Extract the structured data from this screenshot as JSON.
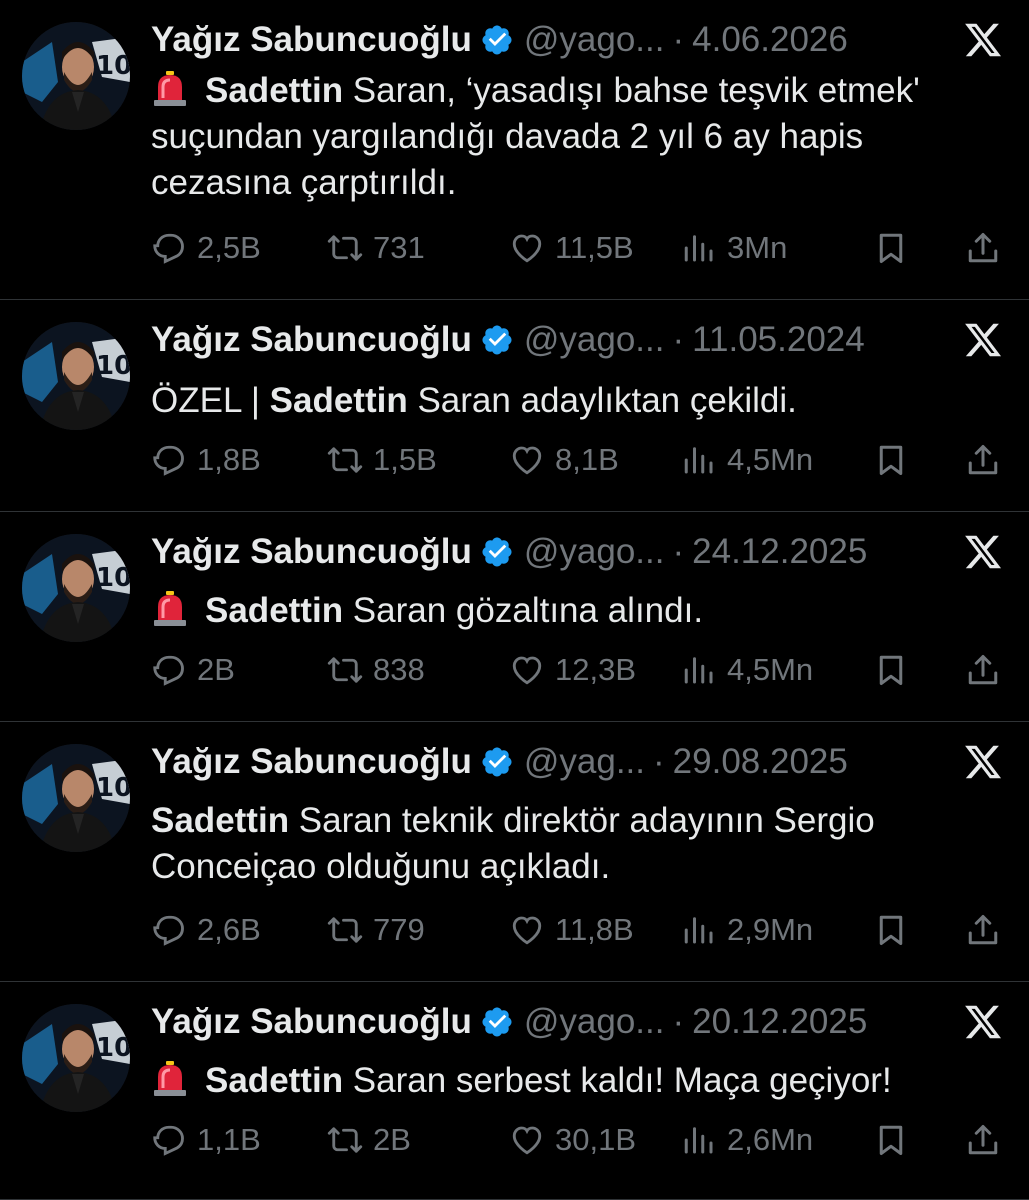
{
  "colors": {
    "background": "#000000",
    "text": "#e7e9ea",
    "muted": "#71767b",
    "verified": "#1d9bf0",
    "divider": "#2f3336"
  },
  "icons": {
    "reply": "reply-icon",
    "retweet": "retweet-icon",
    "like": "heart-icon",
    "views": "views-icon",
    "bookmark": "bookmark-icon",
    "share": "share-icon",
    "verified": "verified-badge-icon",
    "platform": "x-logo-icon",
    "siren": "siren-emoji-icon"
  },
  "tweets": [
    {
      "author": "Yağız Sabuncuoğlu",
      "handle": "@yago...",
      "date": "4.06.2026",
      "prefix": "",
      "bold": "Sadettin",
      "text": " Saran, ‘yasadışı bahse teşvik etmek' suçundan yargılandığı davada 2 yıl 6 ay hapis cezasına çarptırıldı.",
      "replies": "2,5B",
      "retweets": "731",
      "likes": "11,5B",
      "views": "3Mn"
    },
    {
      "author": "Yağız Sabuncuoğlu",
      "handle": "@yago...",
      "date": "11.05.2024",
      "prefix": "ÖZEL | ",
      "bold": "Sadettin",
      "text": " Saran adaylıktan çekildi.",
      "replies": "1,8B",
      "retweets": "1,5B",
      "likes": "8,1B",
      "views": "4,5Mn"
    },
    {
      "author": "Yağız Sabuncuoğlu",
      "handle": "@yago...",
      "date": "24.12.2025",
      "prefix": "",
      "bold": "Sadettin",
      "text": " Saran gözaltına alındı.",
      "replies": "2B",
      "retweets": "838",
      "likes": "12,3B",
      "views": "4,5Mn"
    },
    {
      "author": "Yağız Sabuncuoğlu",
      "handle": "@yag...",
      "date": "29.08.2025",
      "prefix": "",
      "bold": "Sadettin",
      "text": " Saran teknik direktör adayının Sergio Conceiçao olduğunu açıkladı.",
      "replies": "2,6B",
      "retweets": "779",
      "likes": "11,8B",
      "views": "2,9Mn"
    },
    {
      "author": "Yağız Sabuncuoğlu",
      "handle": "@yago...",
      "date": "20.12.2025",
      "prefix": "",
      "bold": "Sadettin",
      "text": " Saran serbest kaldı! Maça geçiyor!",
      "replies": "1,1B",
      "retweets": "2B",
      "likes": "30,1B",
      "views": "2,6Mn"
    }
  ]
}
